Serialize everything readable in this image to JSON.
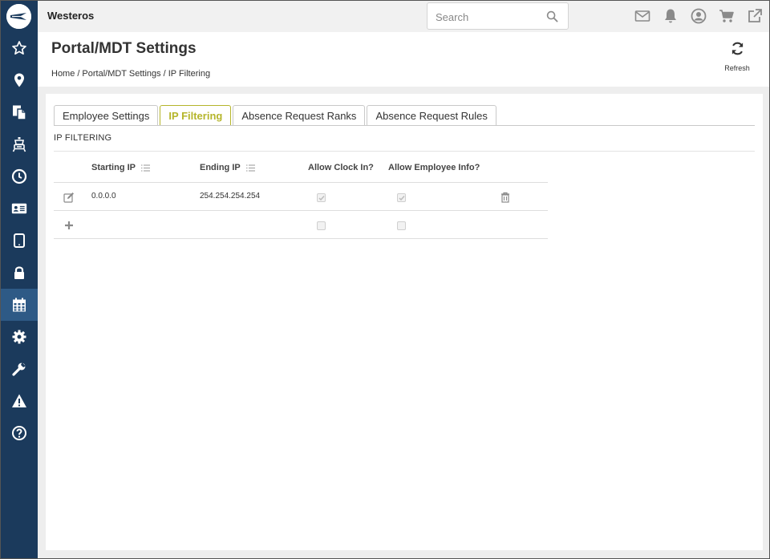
{
  "app": {
    "brand": "Westeros"
  },
  "search": {
    "placeholder": "Search"
  },
  "sidebar": {
    "logo_icon": "logo-icon",
    "items": [
      {
        "icon": "star-icon"
      },
      {
        "icon": "map-marker-icon"
      },
      {
        "icon": "copy-documents-icon"
      },
      {
        "icon": "fire-truck-icon"
      },
      {
        "icon": "clock-icon"
      },
      {
        "icon": "id-card-icon"
      },
      {
        "icon": "tablet-icon"
      },
      {
        "icon": "lock-icon"
      },
      {
        "icon": "calendar-icon",
        "active": true
      },
      {
        "icon": "gear-icon"
      },
      {
        "icon": "wrench-icon"
      },
      {
        "icon": "warning-icon"
      },
      {
        "icon": "help-icon"
      }
    ]
  },
  "topbar_icons": [
    "mail-icon",
    "bell-icon",
    "user-icon",
    "cart-icon",
    "external-link-icon"
  ],
  "header": {
    "title": "Portal/MDT Settings",
    "breadcrumb": [
      "Home",
      "Portal/MDT Settings",
      "IP Filtering"
    ],
    "refresh_label": "Refresh"
  },
  "tabs": [
    {
      "label": "Employee Settings",
      "active": false
    },
    {
      "label": "IP Filtering",
      "active": true
    },
    {
      "label": "Absence Request Ranks",
      "active": false
    },
    {
      "label": "Absence Request Rules",
      "active": false
    }
  ],
  "section": {
    "label": "IP FILTERING"
  },
  "table": {
    "columns": [
      "Starting IP",
      "Ending IP",
      "Allow Clock In?",
      "Allow Employee Info?"
    ],
    "rows": [
      {
        "starting_ip": "0.0.0.0",
        "ending_ip": "254.254.254.254",
        "allow_clock_in": true,
        "allow_employee_info": true
      }
    ],
    "new_row": {
      "allow_clock_in": false,
      "allow_employee_info": false
    }
  },
  "colors": {
    "sidebar": "#1b3a5c",
    "sidebar_active": "#2e5a86",
    "active_tab": "#b5b52b",
    "topbar_icon": "#8a8a8a"
  }
}
